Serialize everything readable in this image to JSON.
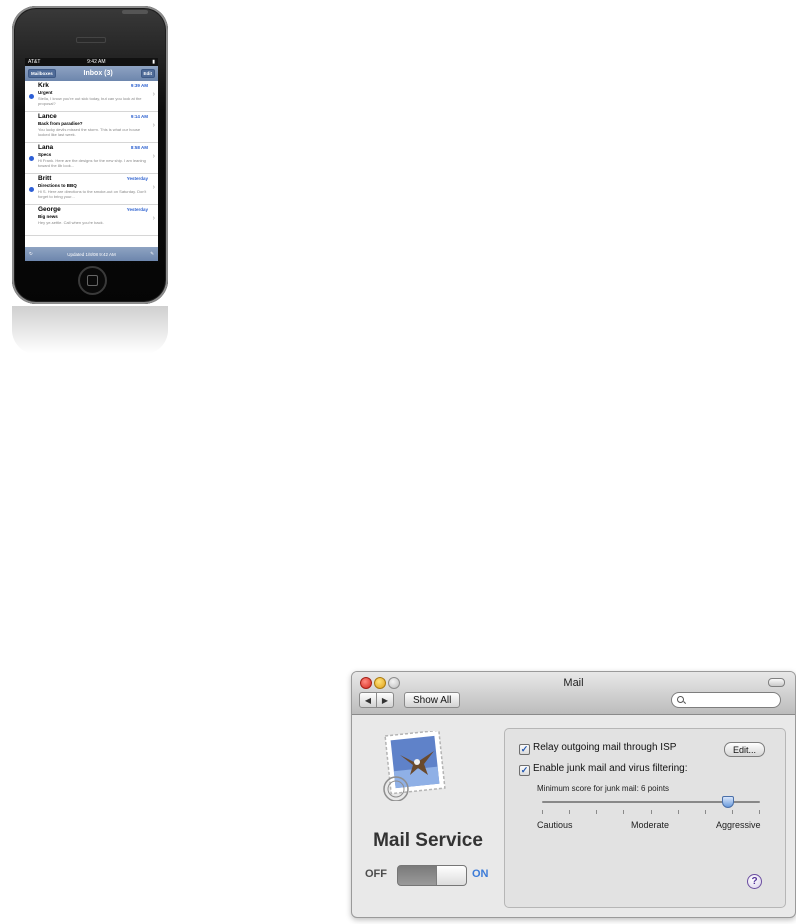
{
  "phone": {
    "status": {
      "carrier": "AT&T",
      "time": "9:42 AM"
    },
    "nav": {
      "back_label": "Mailboxes",
      "title": "Inbox (3)",
      "edit_label": "Edit"
    },
    "messages": [
      {
        "from": "Krk",
        "time": "9:39 AM",
        "subject": "Urgent",
        "preview": "Stella, I know you're out sick today, but can you look at the proposal?",
        "unread": true
      },
      {
        "from": "Lance",
        "time": "9:14 AM",
        "subject": "Back from paradise?",
        "preview": "You lucky devils missed the storm. This is what our house looked like last week.",
        "unread": false
      },
      {
        "from": "Lana",
        "time": "8:58 AM",
        "subject": "Specs",
        "preview": "Hi Frank. Here are the designs for the new ship. I am leaning toward the 8b look...",
        "unread": true
      },
      {
        "from": "Britt",
        "time": "Yesterday",
        "subject": "Directions to BBQ",
        "preview": "Hi S. Here are directions to the smoke-out on Saturday. Don't forget to bring your...",
        "unread": true
      },
      {
        "from": "George",
        "time": "Yesterday",
        "subject": "Big news",
        "preview": "Hey ye-settle. Call when you're back.",
        "unread": false
      }
    ],
    "toolbar": {
      "updated": "Updated 1/8/08 9:42 AM"
    }
  },
  "window": {
    "title": "Mail",
    "show_all": "Show All",
    "search_placeholder": "",
    "service_name": "Mail Service",
    "off_label": "OFF",
    "on_label": "ON",
    "service_on": true,
    "relay_label": "Relay outgoing mail through ISP",
    "relay_checked": true,
    "edit_label": "Edit...",
    "junk_label": "Enable junk mail and virus filtering:",
    "junk_checked": true,
    "min_score_label": "Minimum score for junk mail:  6 points",
    "slider": {
      "min_label": "Cautious",
      "mid_label": "Moderate",
      "max_label": "Aggressive",
      "value_fraction": 0.85
    },
    "help_label": "?"
  },
  "colors": {
    "unread_dot": "#2d5fd6",
    "on_label": "#3c7bd8",
    "phone_bar": "#7990b4"
  }
}
